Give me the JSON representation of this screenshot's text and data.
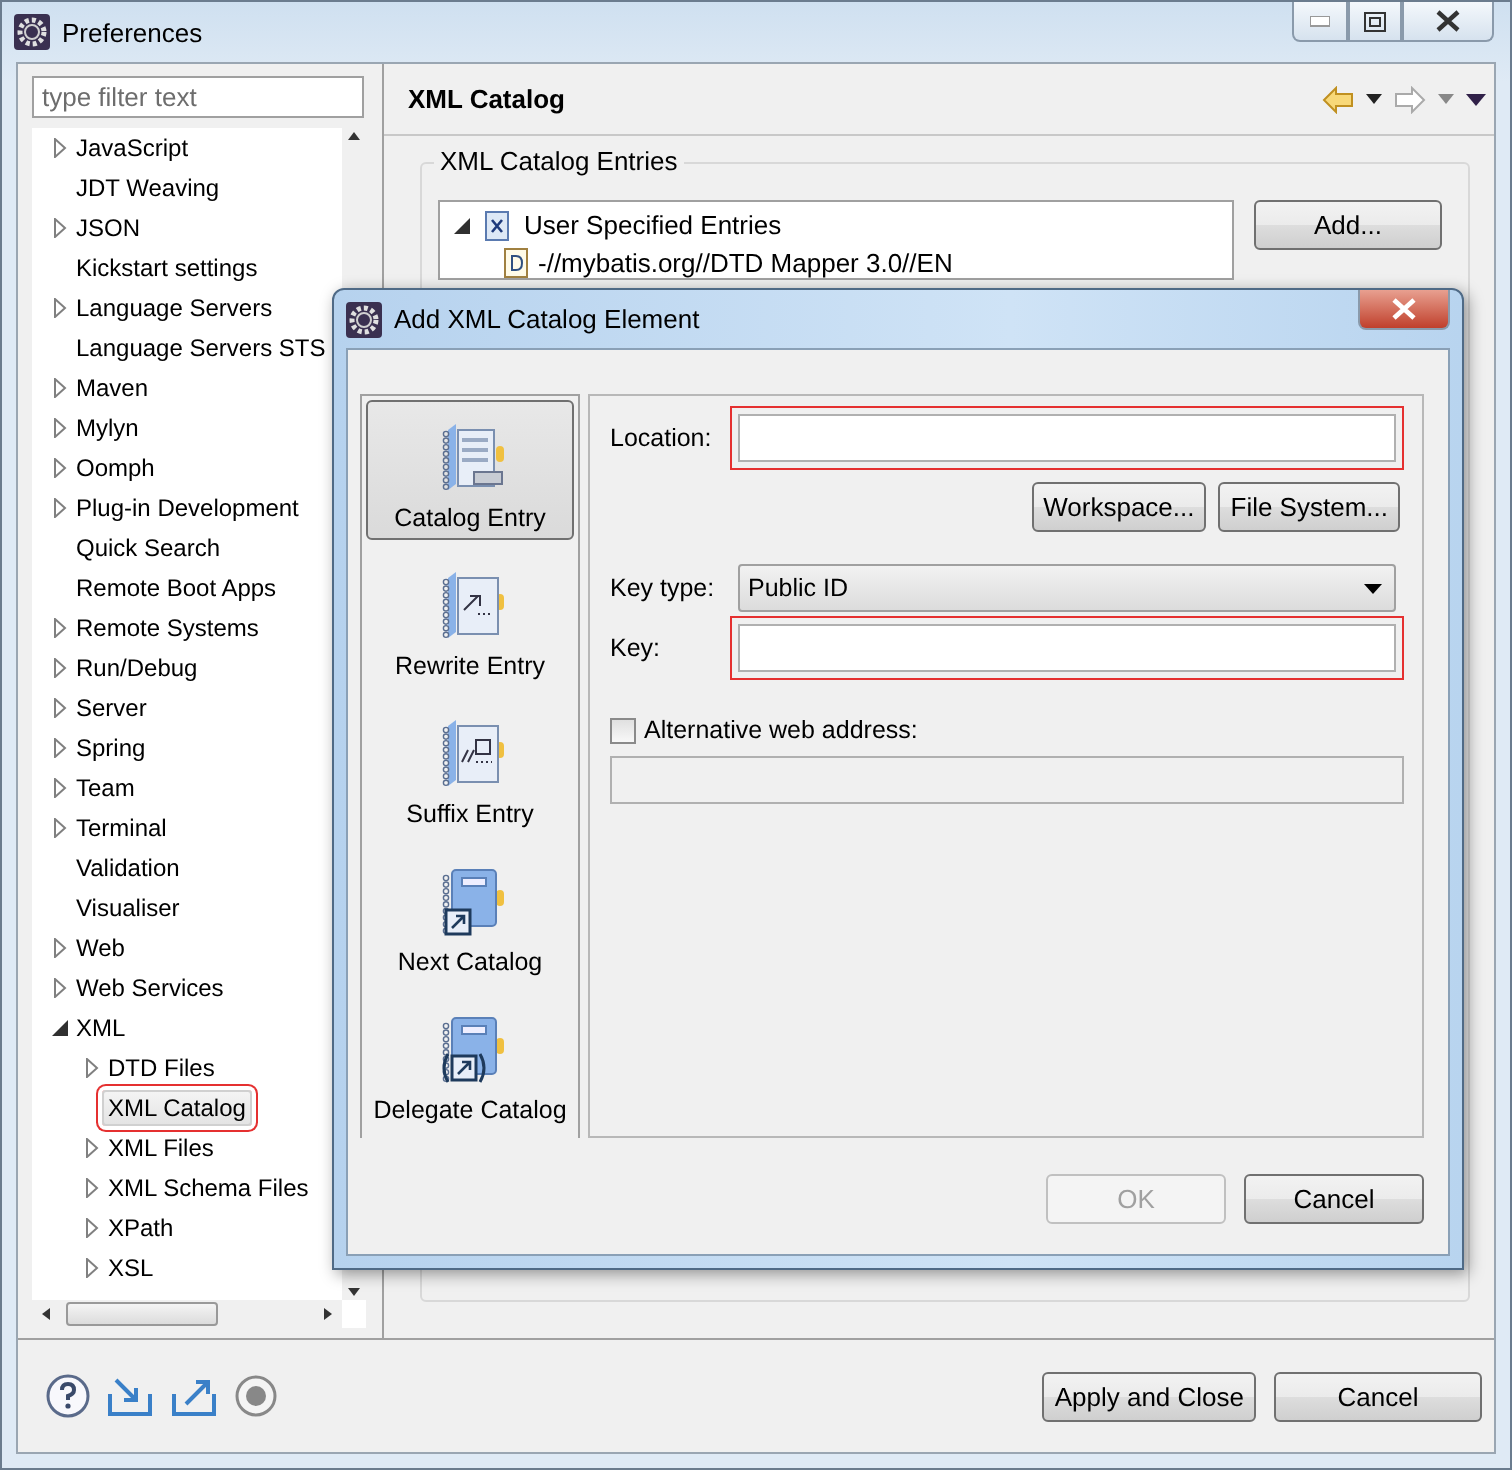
{
  "window": {
    "title": "Preferences"
  },
  "filter": {
    "placeholder": "type filter text"
  },
  "tree": [
    {
      "label": "JavaScript",
      "expandable": true,
      "expanded": false,
      "selected": false,
      "annotated": false
    },
    {
      "label": "JDT Weaving",
      "expandable": false,
      "selected": false,
      "annotated": false
    },
    {
      "label": "JSON",
      "expandable": true,
      "expanded": false,
      "selected": false,
      "annotated": false
    },
    {
      "label": "Kickstart settings",
      "expandable": false,
      "selected": false,
      "annotated": false
    },
    {
      "label": "Language Servers",
      "expandable": true,
      "expanded": false,
      "selected": false,
      "annotated": false
    },
    {
      "label": "Language Servers STS",
      "expandable": false,
      "selected": false,
      "annotated": false
    },
    {
      "label": "Maven",
      "expandable": true,
      "expanded": false,
      "selected": false,
      "annotated": false
    },
    {
      "label": "Mylyn",
      "expandable": true,
      "expanded": false,
      "selected": false,
      "annotated": false
    },
    {
      "label": "Oomph",
      "expandable": true,
      "expanded": false,
      "selected": false,
      "annotated": false
    },
    {
      "label": "Plug-in Development",
      "expandable": true,
      "expanded": false,
      "selected": false,
      "annotated": false
    },
    {
      "label": "Quick Search",
      "expandable": false,
      "selected": false,
      "annotated": false
    },
    {
      "label": "Remote Boot Apps",
      "expandable": false,
      "selected": false,
      "annotated": false
    },
    {
      "label": "Remote Systems",
      "expandable": true,
      "expanded": false,
      "selected": false,
      "annotated": false
    },
    {
      "label": "Run/Debug",
      "expandable": true,
      "expanded": false,
      "selected": false,
      "annotated": false
    },
    {
      "label": "Server",
      "expandable": true,
      "expanded": false,
      "selected": false,
      "annotated": false
    },
    {
      "label": "Spring",
      "expandable": true,
      "expanded": false,
      "selected": false,
      "annotated": false
    },
    {
      "label": "Team",
      "expandable": true,
      "expanded": false,
      "selected": false,
      "annotated": false
    },
    {
      "label": "Terminal",
      "expandable": true,
      "expanded": false,
      "selected": false,
      "annotated": false
    },
    {
      "label": "Validation",
      "expandable": false,
      "selected": false,
      "annotated": false
    },
    {
      "label": "Visualiser",
      "expandable": false,
      "selected": false,
      "annotated": false
    },
    {
      "label": "Web",
      "expandable": true,
      "expanded": false,
      "selected": false,
      "annotated": false
    },
    {
      "label": "Web Services",
      "expandable": true,
      "expanded": false,
      "selected": false,
      "annotated": false
    },
    {
      "label": "XML",
      "expandable": true,
      "expanded": true,
      "selected": false,
      "annotated": false,
      "children": [
        {
          "label": "DTD Files",
          "expandable": true,
          "expanded": false,
          "selected": false,
          "annotated": false
        },
        {
          "label": "XML Catalog",
          "expandable": false,
          "selected": true,
          "annotated": true
        },
        {
          "label": "XML Files",
          "expandable": true,
          "expanded": false,
          "selected": false,
          "annotated": false
        },
        {
          "label": "XML Schema Files",
          "expandable": true,
          "expanded": false,
          "selected": false,
          "annotated": false
        },
        {
          "label": "XPath",
          "expandable": true,
          "expanded": false,
          "selected": false,
          "annotated": false
        },
        {
          "label": "XSL",
          "expandable": true,
          "expanded": false,
          "selected": false,
          "annotated": false
        }
      ]
    }
  ],
  "page": {
    "title": "XML Catalog",
    "group_title": "XML Catalog Entries",
    "entries": [
      {
        "label": "User Specified Entries",
        "expanded": true,
        "children": [
          {
            "label": "-//mybatis.org//DTD Mapper 3.0//EN"
          }
        ]
      }
    ],
    "add_button": "Add..."
  },
  "dialog": {
    "title": "Add XML Catalog Element",
    "types": [
      {
        "kind": "entry",
        "label": "Catalog Entry",
        "selected": true
      },
      {
        "kind": "rewrite",
        "label": "Rewrite Entry",
        "selected": false
      },
      {
        "kind": "suffix",
        "label": "Suffix Entry",
        "selected": false
      },
      {
        "kind": "next",
        "label": "Next Catalog",
        "selected": false
      },
      {
        "kind": "delegate",
        "label": "Delegate Catalog",
        "selected": false
      }
    ],
    "location": {
      "label": "Location:",
      "annotated": true
    },
    "browse_buttons": [
      "Workspace...",
      "File System..."
    ],
    "key_type": {
      "label": "Key type:",
      "value": "Public ID"
    },
    "key": {
      "label": "Key:",
      "annotated": true
    },
    "alternative": {
      "label": "Alternative web address:",
      "checked": false,
      "disabled": true
    },
    "buttons": [
      {
        "label": "OK",
        "disabled": true
      },
      {
        "label": "Cancel",
        "disabled": false
      }
    ]
  },
  "footer_buttons": [
    "Apply and Close",
    "Cancel"
  ]
}
